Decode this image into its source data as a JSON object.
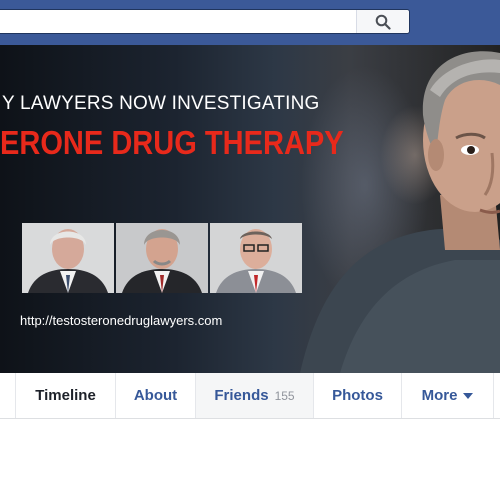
{
  "search": {
    "value": "",
    "placeholder": ""
  },
  "cover": {
    "headline_line1": "Y LAWYERS NOW INVESTIGATING",
    "headline_line2": "ERONE DRUG THERAPY",
    "url": "http://testosteronedruglawyers.com"
  },
  "tabs": [
    {
      "label": "Timeline",
      "active": true
    },
    {
      "label": "About"
    },
    {
      "label": "Friends",
      "count": "155"
    },
    {
      "label": "Photos"
    },
    {
      "label": "More"
    }
  ],
  "colors": {
    "topbar": "#3b5998",
    "link": "#365899",
    "headline_accent": "#e8291b"
  }
}
